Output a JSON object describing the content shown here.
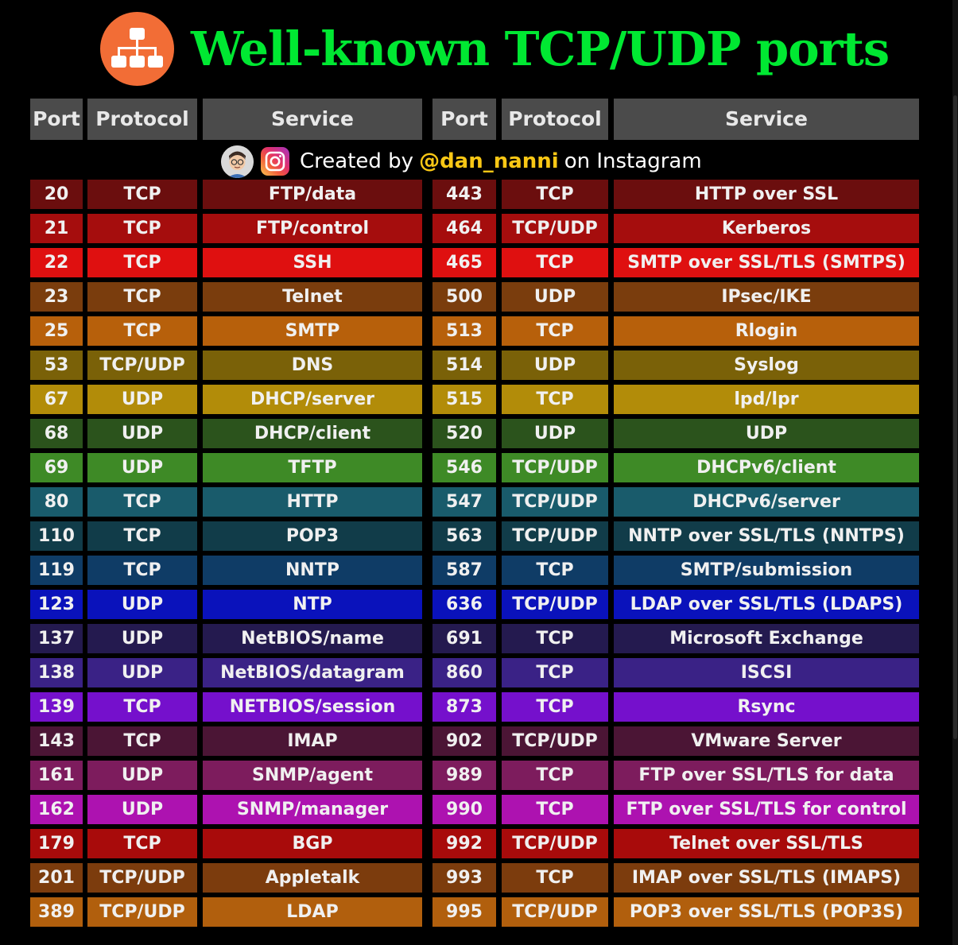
{
  "title": "Well-known TCP/UDP ports",
  "icons": {
    "logo": "network-hierarchy-icon",
    "avatar": "avatar-icon",
    "instagram": "instagram-icon"
  },
  "colors": {
    "title": "#00e832",
    "logo_bg": "#f26d36",
    "header_bg": "#4b4b4b",
    "handle": "#f9c715"
  },
  "header": {
    "left": {
      "port": "Port",
      "protocol": "Protocol",
      "service": "Service"
    },
    "right": {
      "port": "Port",
      "protocol": "Protocol",
      "service": "Service"
    }
  },
  "credit": {
    "prefix": "Created by",
    "handle": "@dan_nanni",
    "suffix": "on Instagram"
  },
  "rows": [
    {
      "color": "#6b0e0e",
      "left": {
        "port": "20",
        "protocol": "TCP",
        "service": "FTP/data"
      },
      "right": {
        "port": "443",
        "protocol": "TCP",
        "service": "HTTP over SSL"
      }
    },
    {
      "color": "#a50d0d",
      "left": {
        "port": "21",
        "protocol": "TCP",
        "service": "FTP/control"
      },
      "right": {
        "port": "464",
        "protocol": "TCP/UDP",
        "service": "Kerberos"
      }
    },
    {
      "color": "#df1010",
      "left": {
        "port": "22",
        "protocol": "TCP",
        "service": "SSH"
      },
      "right": {
        "port": "465",
        "protocol": "TCP",
        "service": "SMTP over SSL/TLS (SMTPS)"
      }
    },
    {
      "color": "#7a3d0d",
      "left": {
        "port": "23",
        "protocol": "TCP",
        "service": "Telnet"
      },
      "right": {
        "port": "500",
        "protocol": "UDP",
        "service": "IPsec/IKE"
      }
    },
    {
      "color": "#b7600b",
      "left": {
        "port": "25",
        "protocol": "TCP",
        "service": "SMTP"
      },
      "right": {
        "port": "513",
        "protocol": "TCP",
        "service": "Rlogin"
      }
    },
    {
      "color": "#7a6108",
      "left": {
        "port": "53",
        "protocol": "TCP/UDP",
        "service": "DNS"
      },
      "right": {
        "port": "514",
        "protocol": "UDP",
        "service": "Syslog"
      }
    },
    {
      "color": "#b28c09",
      "left": {
        "port": "67",
        "protocol": "UDP",
        "service": "DHCP/server"
      },
      "right": {
        "port": "515",
        "protocol": "TCP",
        "service": "lpd/lpr"
      }
    },
    {
      "color": "#2b531c",
      "left": {
        "port": "68",
        "protocol": "UDP",
        "service": "DHCP/client"
      },
      "right": {
        "port": "520",
        "protocol": "UDP",
        "service": "UDP"
      }
    },
    {
      "color": "#3e8a26",
      "left": {
        "port": "69",
        "protocol": "UDP",
        "service": "TFTP"
      },
      "right": {
        "port": "546",
        "protocol": "TCP/UDP",
        "service": "DHCPv6/client"
      }
    },
    {
      "color": "#195b6b",
      "left": {
        "port": "80",
        "protocol": "TCP",
        "service": "HTTP"
      },
      "right": {
        "port": "547",
        "protocol": "TCP/UDP",
        "service": "DHCPv6/server"
      }
    },
    {
      "color": "#113c49",
      "left": {
        "port": "110",
        "protocol": "TCP",
        "service": "POP3"
      },
      "right": {
        "port": "563",
        "protocol": "TCP/UDP",
        "service": "NNTP over SSL/TLS (NNTPS)"
      }
    },
    {
      "color": "#0f3c66",
      "left": {
        "port": "119",
        "protocol": "TCP",
        "service": "NNTP"
      },
      "right": {
        "port": "587",
        "protocol": "TCP",
        "service": "SMTP/submission"
      }
    },
    {
      "color": "#0a12bb",
      "left": {
        "port": "123",
        "protocol": "UDP",
        "service": "NTP"
      },
      "right": {
        "port": "636",
        "protocol": "TCP/UDP",
        "service": "LDAP over SSL/TLS (LDAPS)"
      }
    },
    {
      "color": "#241a4f",
      "left": {
        "port": "137",
        "protocol": "UDP",
        "service": "NetBIOS/name"
      },
      "right": {
        "port": "691",
        "protocol": "TCP",
        "service": "Microsoft Exchange"
      }
    },
    {
      "color": "#3a2286",
      "left": {
        "port": "138",
        "protocol": "UDP",
        "service": "NetBIOS/datagram"
      },
      "right": {
        "port": "860",
        "protocol": "TCP",
        "service": "ISCSI"
      }
    },
    {
      "color": "#7510cc",
      "left": {
        "port": "139",
        "protocol": "TCP",
        "service": "NETBIOS/session"
      },
      "right": {
        "port": "873",
        "protocol": "TCP",
        "service": "Rsync"
      }
    },
    {
      "color": "#4b1535",
      "left": {
        "port": "143",
        "protocol": "TCP",
        "service": "IMAP"
      },
      "right": {
        "port": "902",
        "protocol": "TCP/UDP",
        "service": "VMware Server"
      }
    },
    {
      "color": "#7d1c5d",
      "left": {
        "port": "161",
        "protocol": "UDP",
        "service": "SNMP/agent"
      },
      "right": {
        "port": "989",
        "protocol": "TCP",
        "service": "FTP over SSL/TLS  for data"
      }
    },
    {
      "color": "#ad12b0",
      "left": {
        "port": "162",
        "protocol": "UDP",
        "service": "SNMP/manager"
      },
      "right": {
        "port": "990",
        "protocol": "TCP",
        "service": "FTP over SSL/TLS for control"
      }
    },
    {
      "color": "#a80b0b",
      "left": {
        "port": "179",
        "protocol": "TCP",
        "service": "BGP"
      },
      "right": {
        "port": "992",
        "protocol": "TCP/UDP",
        "service": "Telnet over SSL/TLS"
      }
    },
    {
      "color": "#7c3c0d",
      "left": {
        "port": "201",
        "protocol": "TCP/UDP",
        "service": "Appletalk"
      },
      "right": {
        "port": "993",
        "protocol": "TCP",
        "service": "IMAP over SSL/TLS (IMAPS)"
      }
    },
    {
      "color": "#b15f0d",
      "left": {
        "port": "389",
        "protocol": "TCP/UDP",
        "service": "LDAP"
      },
      "right": {
        "port": "995",
        "protocol": "TCP/UDP",
        "service": "POP3 over SSL/TLS (POP3S)"
      }
    }
  ]
}
